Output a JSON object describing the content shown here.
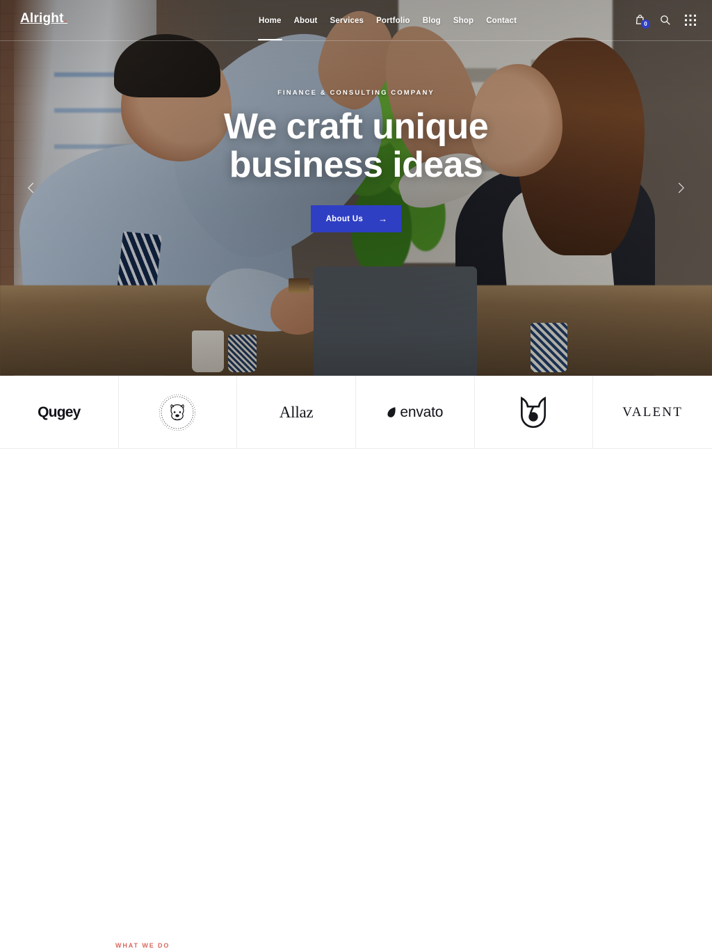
{
  "site": {
    "logo_text": "Alright",
    "logo_dot": ".",
    "accent_blue": "#2f3fc4",
    "accent_coral": "#d9685f"
  },
  "header": {
    "nav": [
      {
        "label": "Home",
        "active": true
      },
      {
        "label": "About",
        "active": false
      },
      {
        "label": "Services",
        "active": false
      },
      {
        "label": "Portfolio",
        "active": false
      },
      {
        "label": "Blog",
        "active": false
      },
      {
        "label": "Shop",
        "active": false
      },
      {
        "label": "Contact",
        "active": false
      }
    ],
    "tools": {
      "cart_icon": "shopping-bag-icon",
      "cart_count": "0",
      "search_icon": "search-icon",
      "grid_icon": "grid-menu-icon"
    }
  },
  "hero": {
    "eyebrow": "FINANCE & CONSULTING COMPANY",
    "headline_line1": "We craft unique",
    "headline_line2": "business ideas",
    "cta_label": "About Us",
    "cta_arrow": "→",
    "prev_arrow": "‹",
    "next_arrow": "›",
    "image_alt": "Two business colleagues high-fiving across an office desk with a laptop"
  },
  "clients": [
    {
      "name": "Qugey",
      "type": "wordmark",
      "style": "round"
    },
    {
      "name": "",
      "type": "mark",
      "style": "bulldog-stamp-logo"
    },
    {
      "name": "Allaz",
      "type": "wordmark",
      "style": "serif"
    },
    {
      "name": "envato",
      "type": "wordmark",
      "style": "envato"
    },
    {
      "name": "",
      "type": "mark",
      "style": "shield-tulip-logo"
    },
    {
      "name": "VALENT",
      "type": "wordmark",
      "style": "wide"
    }
  ],
  "what_we_do": {
    "label": "WHAT WE DO"
  }
}
